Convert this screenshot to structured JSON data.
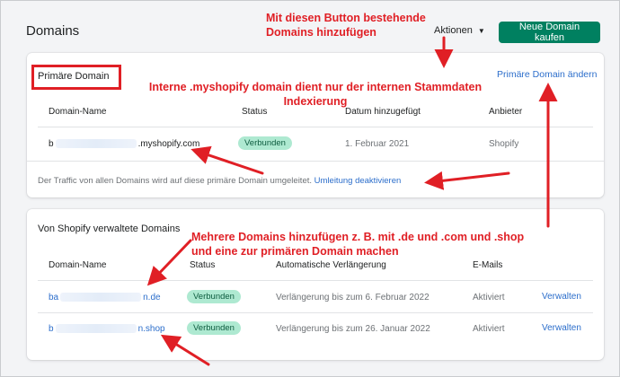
{
  "header": {
    "title": "Domains",
    "actions_label": "Aktionen",
    "buy_button": "Neue Domain kaufen"
  },
  "primary_card": {
    "title": "Primäre Domain",
    "change_link": "Primäre Domain ändern",
    "columns": [
      "Domain-Name",
      "Status",
      "Datum hinzugefügt",
      "Anbieter"
    ],
    "row": {
      "domain_start": "b",
      "domain_end": ".myshopify.com",
      "status": "Verbunden",
      "date": "1. Februar 2021",
      "provider": "Shopify"
    },
    "footer_text": "Der Traffic von allen Domains wird auf diese primäre Domain umgeleitet.",
    "footer_link": "Umleitung deaktivieren"
  },
  "managed_card": {
    "title": "Von Shopify verwaltete Domains",
    "columns": [
      "Domain-Name",
      "Status",
      "Automatische Verlängerung",
      "E-Mails"
    ],
    "rows": [
      {
        "domain_start": "ba",
        "domain_end": "n.de",
        "status": "Verbunden",
        "renewal": "Verlängerung bis zum 6. Februar 2022",
        "emails": "Aktiviert",
        "action": "Verwalten"
      },
      {
        "domain_start": "b",
        "domain_end": "n.shop",
        "status": "Verbunden",
        "renewal": "Verlängerung bis zum 26. Januar 2022",
        "emails": "Aktiviert",
        "action": "Verwalten"
      }
    ]
  },
  "annotations": {
    "button_note": [
      "Mit diesen Button bestehende",
      "Domains hinzufügen"
    ],
    "myshopify_note": [
      "Interne .myshopify domain dient nur der internen Stammdaten",
      "Indexierung"
    ],
    "multi_note": [
      "Mehrere Domains hinzufügen z. B. mit .de und .com und .shop",
      "und eine zur primären Domain machen"
    ]
  },
  "colors": {
    "annotation_red": "#e01f25",
    "accent_green": "#008060",
    "link_blue": "#2c6ecb",
    "badge_green": "#aee9d1"
  }
}
